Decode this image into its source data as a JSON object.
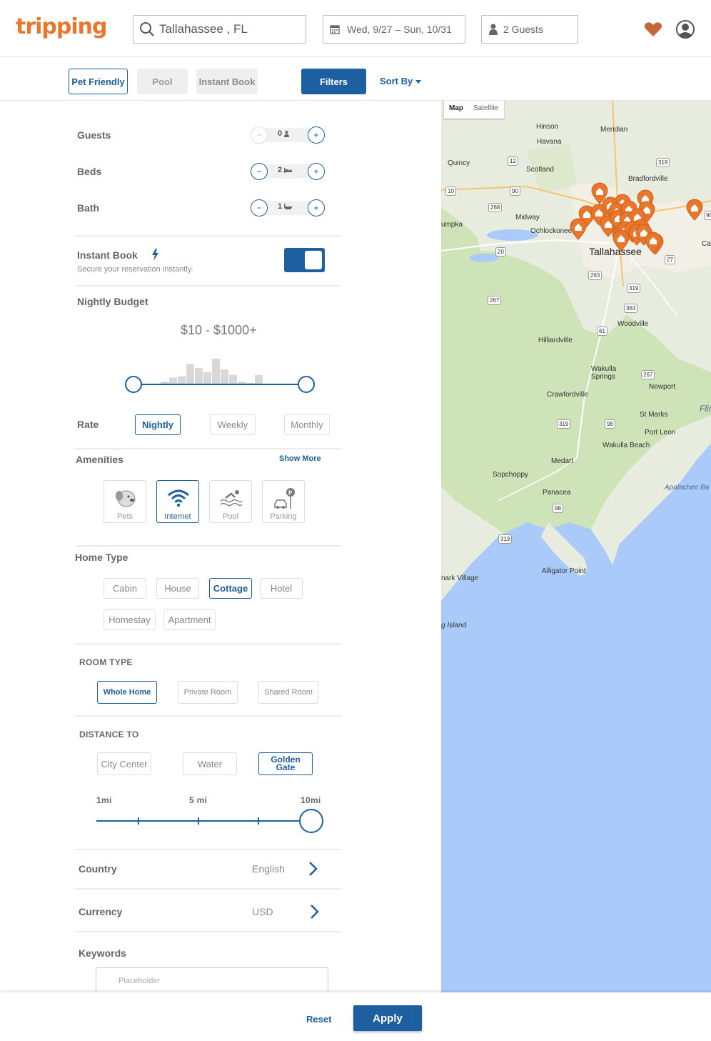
{
  "header": {
    "logo": "tripping",
    "search_value": "Tallahassee , FL",
    "dates": "Wed, 9/27 – Sun, 10/31",
    "guests": "2 Guests"
  },
  "filterbar": {
    "pet_friendly": "Pet Friendly",
    "pool": "Pool",
    "instant_book": "Instant Book",
    "filters": "Filters",
    "sort_by": "Sort By"
  },
  "counters": {
    "guests_label": "Guests",
    "guests_value": "0",
    "beds_label": "Beds",
    "beds_value": "2",
    "bath_label": "Bath",
    "bath_value": "1",
    "minus": "−",
    "plus": "+"
  },
  "instant_book": {
    "label": "Instant Book",
    "description": "Secure your reservation instantly.",
    "enabled": true
  },
  "budget": {
    "label": "Nightly Budget",
    "range_text": "$10 - $1000+",
    "min": 10,
    "max": 1000,
    "histogram": [
      0.1,
      0.25,
      0.3,
      0.75,
      0.6,
      0.45,
      0.95,
      0.55,
      0.35,
      0.1,
      0.05,
      0.35
    ]
  },
  "rate": {
    "label": "Rate",
    "options": [
      "Nightly",
      "Weekly",
      "Monthly"
    ],
    "selected": "Nightly"
  },
  "amenities": {
    "label": "Amenities",
    "show_more": "Show More",
    "items": [
      "Pets",
      "Internet",
      "Pool",
      "Parking"
    ],
    "selected": "Internet"
  },
  "home_type": {
    "label": "Home Type",
    "options": [
      "Cabin",
      "House",
      "Cottage",
      "Hotel",
      "Homestay",
      "Apartment"
    ],
    "selected": "Cottage"
  },
  "room_type": {
    "label": "ROOM TYPE",
    "options": [
      "Whole Home",
      "Private Room",
      "Shared Room"
    ],
    "selected": "Whole Home"
  },
  "distance": {
    "label": "DISTANCE TO",
    "options": [
      "City Center",
      "Water",
      "Golden Gate"
    ],
    "selected": "Golden Gate",
    "scale": [
      "1mi",
      "5 mi",
      "10mi"
    ],
    "value_mi": 10
  },
  "country": {
    "label": "Country",
    "value": "English"
  },
  "currency": {
    "label": "Currency",
    "value": "USD"
  },
  "keywords": {
    "label": "Keywords",
    "placeholder": "Placeholder"
  },
  "map": {
    "tab_map": "Map",
    "tab_satellite": "Satellite",
    "towns": [
      "Hinson",
      "Meridian",
      "Havana",
      "Quincy",
      "Scotland",
      "Bradfordville",
      "Midway",
      "Ochlockonee",
      "Tallahassee",
      "Woodville",
      "Hilliardville",
      "Wakulla Springs",
      "Newport",
      "Crawfordville",
      "St Marks",
      "Port Leon",
      "Wakulla Beach",
      "Medart",
      "Sopchoppy",
      "Panacea",
      "Alligator Point",
      "Apalachee Ba",
      "nark Village",
      "g Island",
      "umpka",
      "Ca",
      "Flir"
    ],
    "routes": [
      "12",
      "319",
      "90",
      "10",
      "268",
      "20",
      "263",
      "267",
      "319",
      "363",
      "61",
      "267",
      "319",
      "98",
      "98",
      "319",
      "27",
      "90"
    ]
  },
  "bottom": {
    "reset": "Reset",
    "apply": "Apply"
  },
  "colors": {
    "brand": "#e9772b",
    "primary": "#1d5fa0",
    "water": "#aacbfa"
  }
}
